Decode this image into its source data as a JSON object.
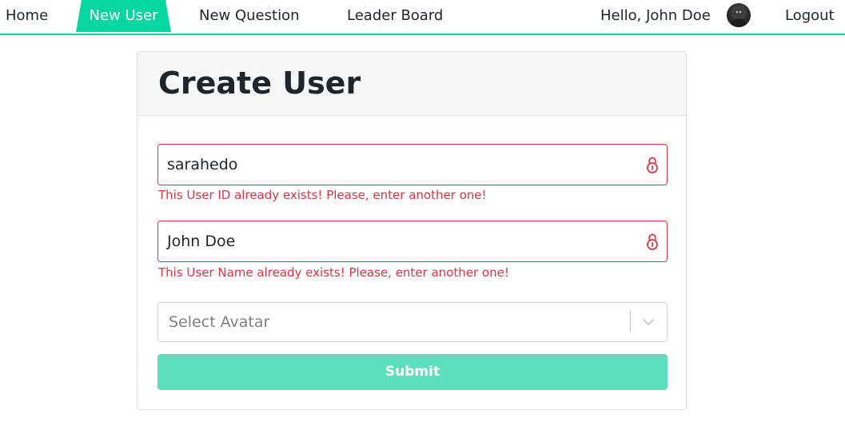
{
  "nav": {
    "home": "Home",
    "new_user": "New User",
    "new_question": "New Question",
    "leader_board": "Leader Board",
    "greeting": "Hello, John Doe",
    "logout": "Logout",
    "accent_color": "#06d6a0"
  },
  "card": {
    "title": "Create User"
  },
  "form": {
    "user_id": {
      "value": "sarahedo",
      "error": "This User ID already exists! Please, enter another one!"
    },
    "user_name": {
      "value": "John Doe",
      "error": "This User Name already exists! Please, enter another one!"
    },
    "avatar_select": {
      "placeholder": "Select Avatar"
    },
    "submit_label": "Submit",
    "error_color": "#dc3545"
  },
  "icons": {
    "field_icon": "lock-icon",
    "select_icon": "chevron-down-icon",
    "avatar": "user-avatar"
  }
}
